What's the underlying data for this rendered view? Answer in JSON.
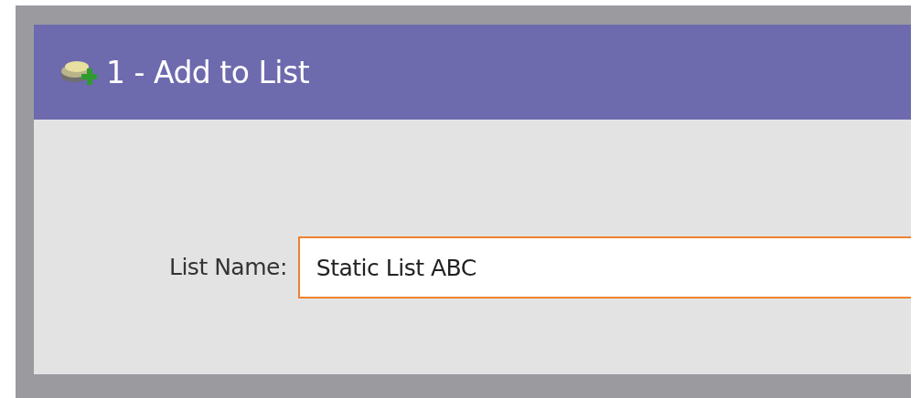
{
  "header": {
    "title": "1 - Add to List"
  },
  "form": {
    "label": "List Name:",
    "value": "Static List ABC"
  }
}
